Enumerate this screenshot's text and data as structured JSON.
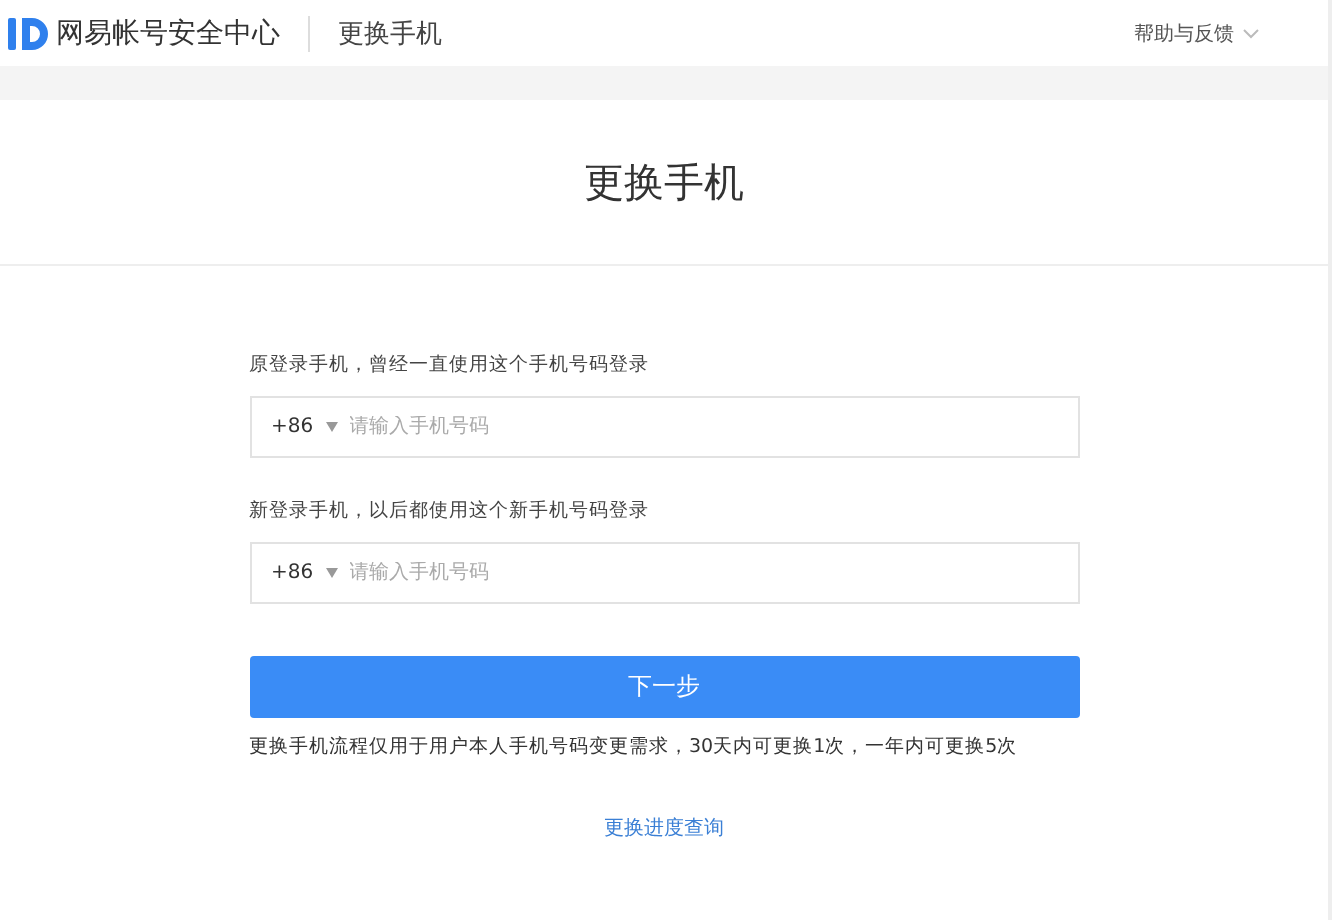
{
  "header": {
    "logo_text": "网易帐号安全中心",
    "page_title": "更换手机",
    "help_link": "帮助与反馈"
  },
  "title": "更换手机",
  "fields": [
    {
      "label": "原登录手机，曾经一直使用这个手机号码登录",
      "country_code": "+86",
      "placeholder": "请输入手机号码"
    },
    {
      "label": "新登录手机，以后都使用这个新手机号码登录",
      "country_code": "+86",
      "placeholder": "请输入手机号码"
    }
  ],
  "submit_button": "下一步",
  "notice": "更换手机流程仅用于用户本人手机号码变更需求，30天内可更换1次，一年内可更换5次",
  "progress_link": "更换进度查询"
}
